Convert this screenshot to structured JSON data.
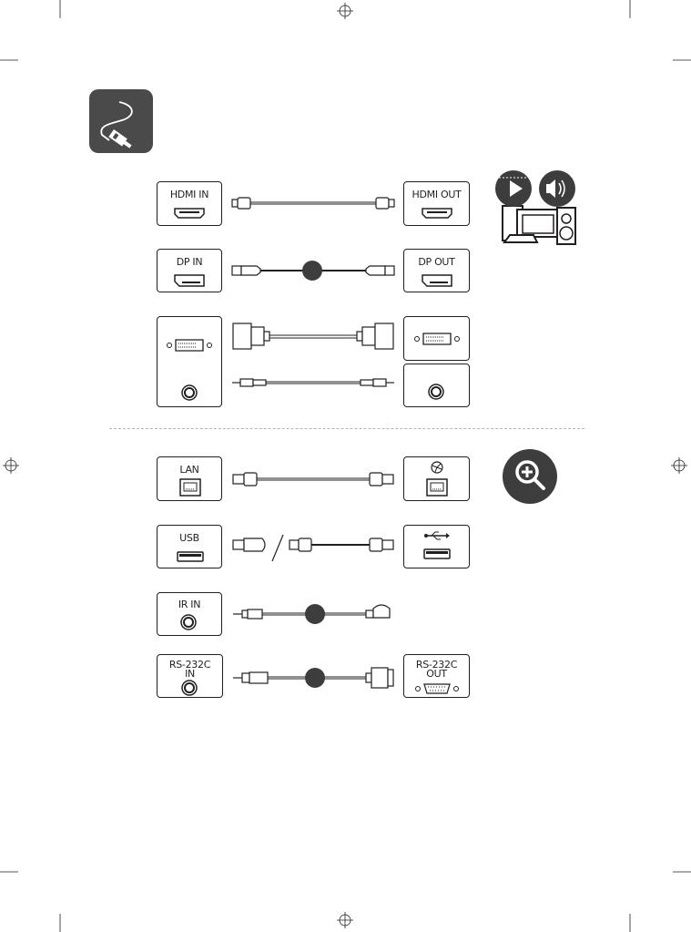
{
  "section_icon": "cable-connection-icon",
  "rows": {
    "hdmi": {
      "in_label": "HDMI IN",
      "out_label": "HDMI OUT"
    },
    "dp": {
      "in_label": "DP IN",
      "out_label": "DP OUT"
    },
    "dvi": {
      "in_label": "",
      "out_label": ""
    },
    "lan": {
      "in_label": "LAN",
      "out_icon": "network-globe-icon"
    },
    "usb": {
      "in_label": "USB",
      "out_icon": "usb-symbol-icon"
    },
    "ir": {
      "in_label": "IR IN"
    },
    "rs232": {
      "in_label_1": "RS-232C",
      "in_label_2": "IN",
      "out_label_1": "RS-232C",
      "out_label_2": "OUT"
    }
  },
  "side_icons": {
    "av_source": "av-source-devices-icon",
    "zoom": "zoom-in-magnifier-icon"
  },
  "colors": {
    "ink": "#231f20",
    "icon_bg": "#4a4a4a",
    "divider": "#b3b3b3"
  }
}
